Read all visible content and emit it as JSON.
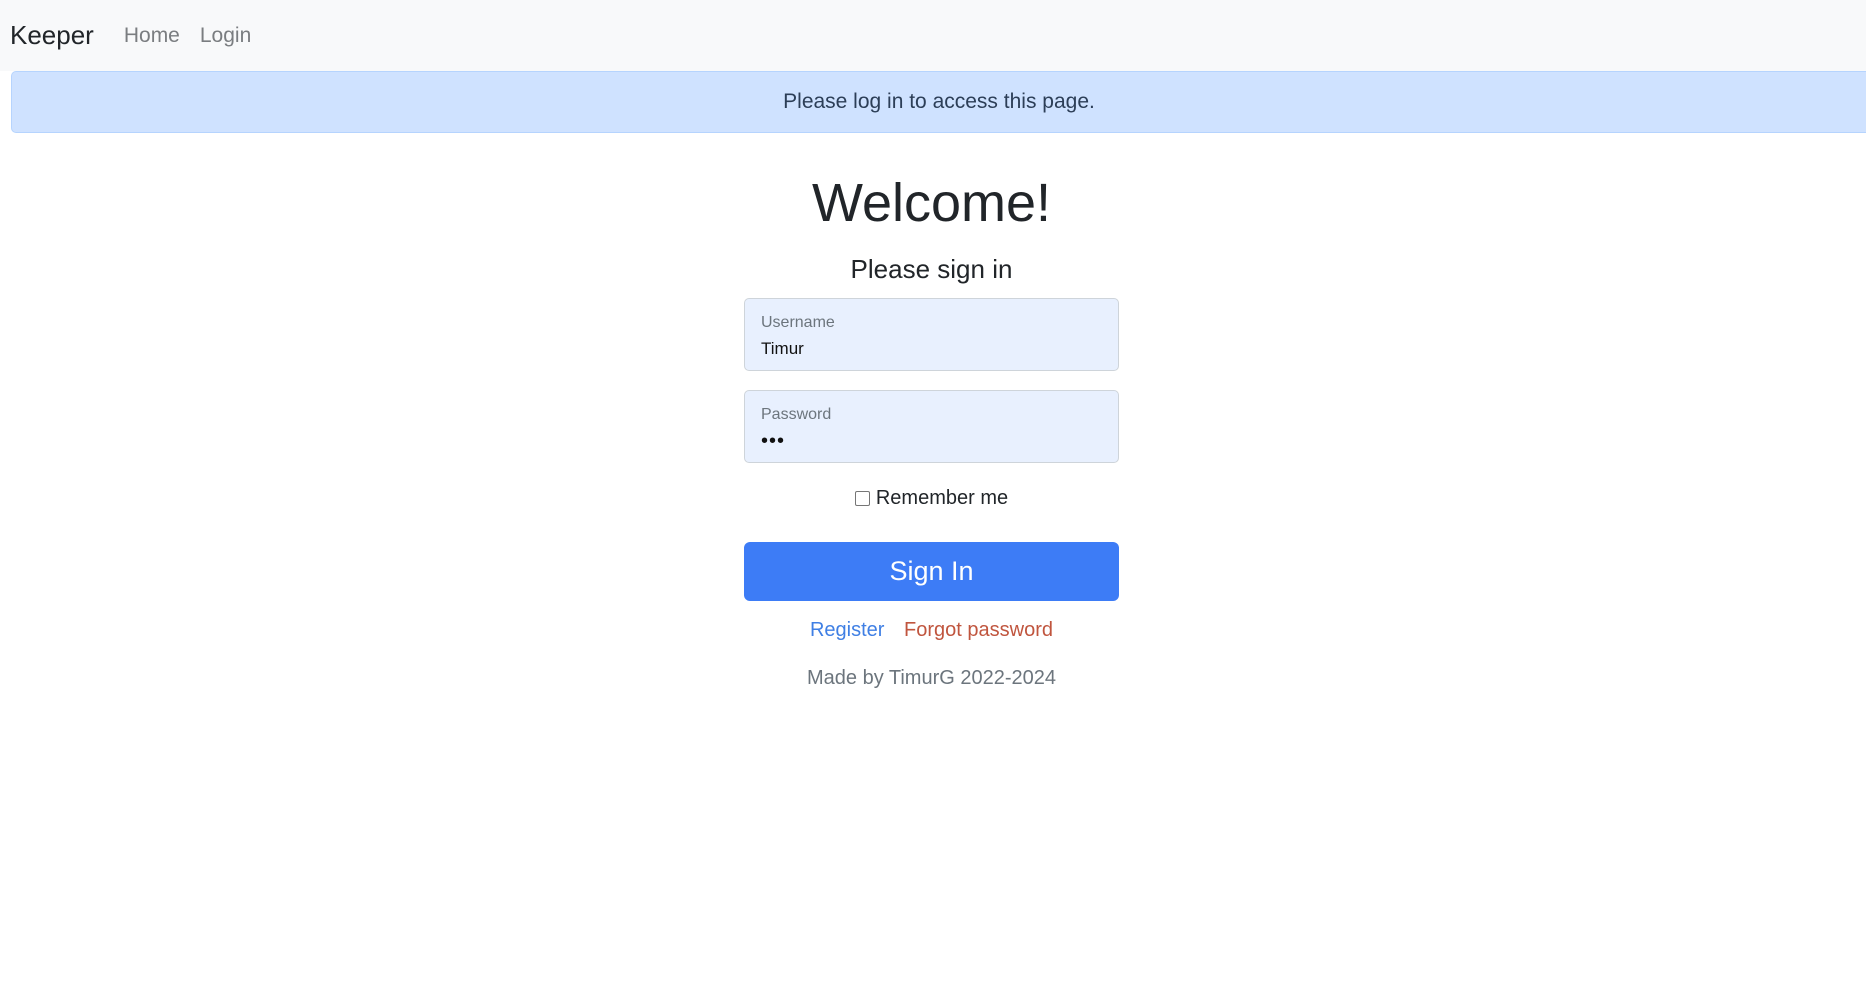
{
  "navbar": {
    "brand": "Keeper",
    "links": [
      "Home",
      "Login"
    ]
  },
  "alert": {
    "message": "Please log in to access this page."
  },
  "login": {
    "title": "Welcome!",
    "subtitle": "Please sign in",
    "username": {
      "label": "Username",
      "value": "Timur"
    },
    "password": {
      "label": "Password",
      "value": "•••"
    },
    "remember_label": "Remember me",
    "remember_checked": false,
    "signin_label": "Sign In",
    "register_label": "Register",
    "forgot_label": "Forgot password",
    "footer": "Made by TimurG 2022-2024"
  },
  "colors": {
    "navbar_bg": "#f8f9fa",
    "alert_bg": "#cfe2ff",
    "field_bg": "#e8f0fe",
    "primary_button": "#3d7cf6",
    "register_link": "#3f7fe4",
    "forgot_link": "#c0553e"
  }
}
